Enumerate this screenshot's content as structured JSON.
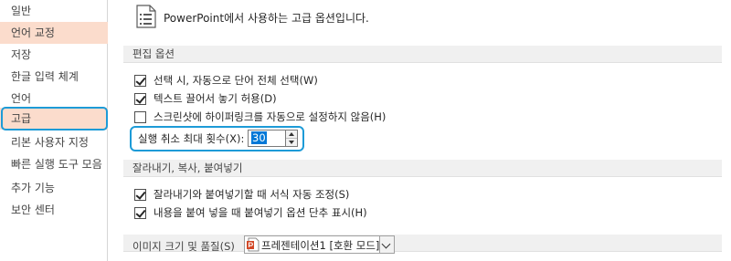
{
  "sidebar": {
    "items": [
      {
        "label": "일반"
      },
      {
        "label": "언어 교정"
      },
      {
        "label": "저장"
      },
      {
        "label": "한글 입력 체계"
      },
      {
        "label": "언어"
      },
      {
        "label": "고급"
      },
      {
        "label": "리본 사용자 지정"
      },
      {
        "label": "빠른 실행 도구 모음"
      },
      {
        "label": "추가 기능"
      },
      {
        "label": "보안 센터"
      }
    ],
    "selected": "고급",
    "hover": "언어 교정"
  },
  "main": {
    "title": "PowerPoint에서 사용하는 고급 옵션입니다.",
    "sections": {
      "editing": {
        "header": "편집 옵션",
        "options": [
          {
            "label": "선택 시, 자동으로 단어 전체 선택(W)",
            "checked": true
          },
          {
            "label": "텍스트 끌어서 놓기 허용(D)",
            "checked": true
          },
          {
            "label": "스크린샷에 하이퍼링크를 자동으로 설정하지 않음(H)",
            "checked": false
          }
        ],
        "undo": {
          "label": "실행 취소 최대 횟수(X):",
          "value": "30"
        }
      },
      "clipboard": {
        "header": "잘라내기, 복사, 붙여넣기",
        "options": [
          {
            "label": "잘라내기와 붙여넣기할 때 서식 자동 조정(S)",
            "checked": true
          },
          {
            "label": "내용을 붙여 넣을 때 붙여넣기 옵션 단추 표시(H)",
            "checked": true
          }
        ]
      },
      "image": {
        "header": "이미지 크기 및 품질(S)",
        "document": "프레젠테이션1 [호환 모드]"
      }
    }
  },
  "colors": {
    "accent": "#1d9bd7",
    "selected_bg": "#fbdccc",
    "header_bg": "#f0f0f0"
  }
}
